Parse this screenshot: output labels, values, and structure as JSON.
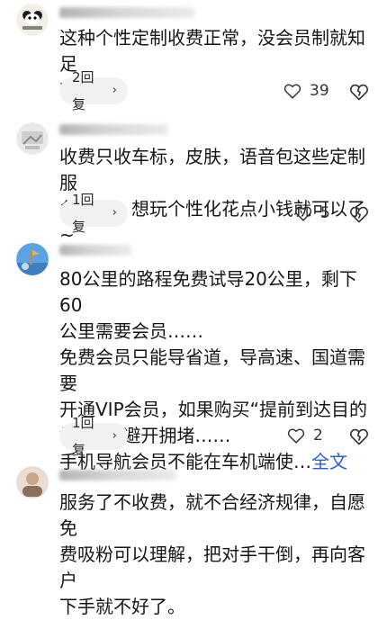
{
  "comments": [
    {
      "text": "这种个性定制收费正常，没会员制就知足\n吧",
      "replies": "2回复",
      "likes": "39"
    },
    {
      "text": "收费只收车标，皮肤，语音包这些定制服\n务就行，想玩个性化花点小钱就可以了~",
      "replies": "1回复",
      "likes": "5"
    },
    {
      "text_main": "80公里的路程免费试导20公里，剩下60\n公里需要会员……\n免费会员只能导省道，导高速、国道需要\n开通VIP会员，如果购买“提前到达目的\n地”可以避开拥堵……\n手机导航会员不能在车机端使…",
      "full_text_link": "全文",
      "replies": "1回复",
      "likes": "2"
    },
    {
      "text": "服务了不收费，就不合经济规律，自愿免\n费吸粉可以理解，把对手干倒，再向客户\n下手就不好了。"
    }
  ],
  "ui": {
    "reply_chevron": "›",
    "like_icon": "heart-outline-icon",
    "dislike_icon": "heart-broken-outline-icon"
  }
}
